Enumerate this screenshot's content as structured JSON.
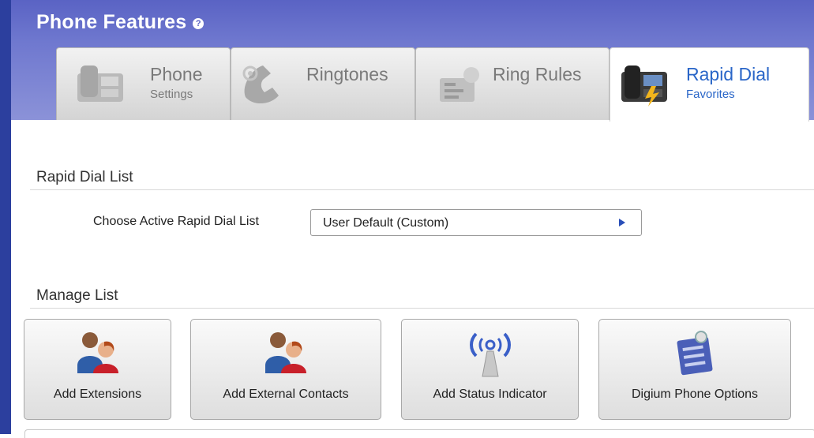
{
  "header": {
    "title": "Phone Features",
    "help_icon": "question-icon"
  },
  "tabs": [
    {
      "label": "Phone",
      "sub": "Settings",
      "icon": "desk-phone-icon",
      "active": false
    },
    {
      "label": "Ringtones",
      "sub": "",
      "icon": "ringing-handset-icon",
      "active": false
    },
    {
      "label": "Ring Rules",
      "sub": "",
      "icon": "ring-rules-icon",
      "active": false
    },
    {
      "label": "Rapid Dial",
      "sub": "Favorites",
      "icon": "rapid-dial-phone-icon",
      "active": true
    }
  ],
  "rapid_dial": {
    "section_title": "Rapid Dial List",
    "choose_label": "Choose Active Rapid Dial List",
    "selected_value": "User Default (Custom)"
  },
  "manage": {
    "section_title": "Manage List",
    "tiles": [
      {
        "label": "Add Extensions",
        "icon": "users-icon"
      },
      {
        "label": "Add External Contacts",
        "icon": "contacts-icon"
      },
      {
        "label": "Add Status Indicator",
        "icon": "status-antenna-icon"
      },
      {
        "label": "Digium Phone Options",
        "icon": "phone-options-icon"
      }
    ]
  },
  "colors": {
    "header": "#5a63c4",
    "accent": "#2a66c8",
    "rail": "#2c3f9e"
  }
}
